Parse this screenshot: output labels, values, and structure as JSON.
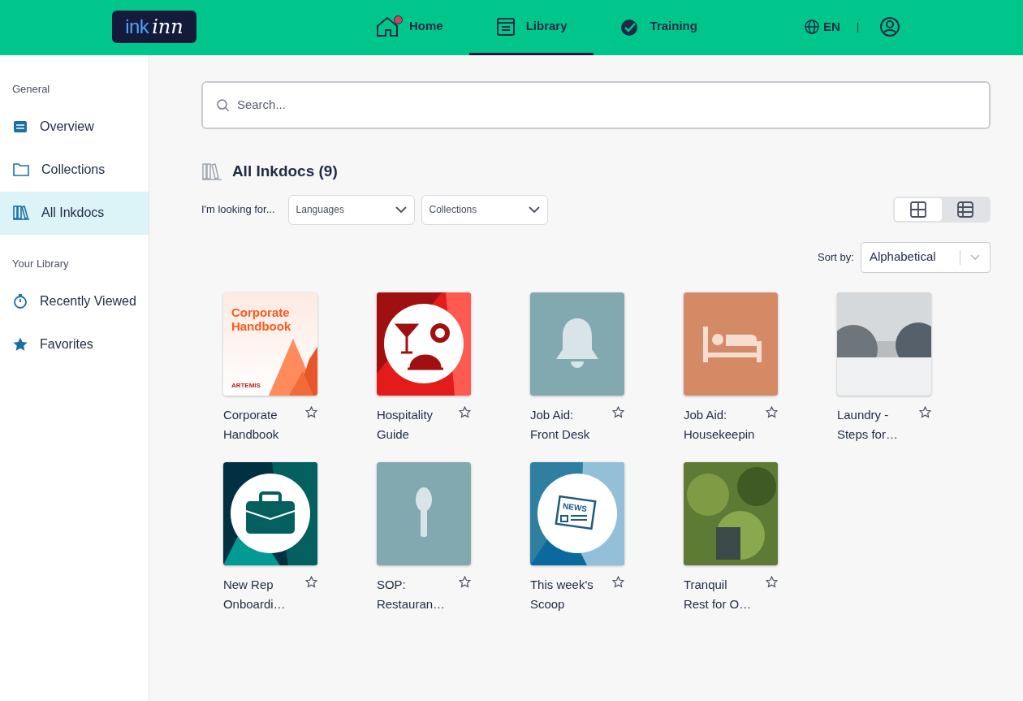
{
  "header": {
    "logo_left": "ink",
    "logo_right": "inn",
    "nav": [
      {
        "label": "Home",
        "kind": "home",
        "selected": false,
        "badge": true
      },
      {
        "label": "Library",
        "kind": "library",
        "selected": true,
        "badge": false
      },
      {
        "label": "Training",
        "kind": "training",
        "selected": false,
        "badge": false
      }
    ],
    "language": "EN"
  },
  "sidebar": {
    "sections": [
      {
        "heading": "General",
        "items": [
          {
            "label": "Overview",
            "kind": "overview",
            "selected": false
          },
          {
            "label": "Collections",
            "kind": "folder",
            "selected": false
          },
          {
            "label": "All Inkdocs",
            "kind": "books",
            "selected": true
          }
        ]
      },
      {
        "heading": "Your Library",
        "items": [
          {
            "label": "Recently Viewed",
            "kind": "timer",
            "selected": false
          },
          {
            "label": "Favorites",
            "kind": "star",
            "selected": false
          }
        ]
      }
    ]
  },
  "search": {
    "placeholder": "Search..."
  },
  "heading": "All Inkdocs (9)",
  "filters": {
    "label": "I'm looking for...",
    "dropdowns": [
      "Languages",
      "Collections"
    ]
  },
  "view_toggle": [
    {
      "kind": "grid",
      "selected": true
    },
    {
      "kind": "list",
      "selected": false
    }
  ],
  "sort": {
    "label": "Sort by:",
    "value": "Alphabetical"
  },
  "docs": [
    {
      "title": "Corporate Handbook",
      "kind": "handbook",
      "cover_title": "Corporate Handbook",
      "cover_brand": "ARTEMIS",
      "favorite": false
    },
    {
      "title": "Hospitality Guide",
      "kind": "hospitality",
      "favorite": false
    },
    {
      "title": "Job Aid: Front Desk",
      "kind": "bell",
      "favorite": false
    },
    {
      "title": "Job Aid: Housekeepin",
      "kind": "bed",
      "favorite": false
    },
    {
      "title": "Laundry - Steps for…",
      "kind": "photo",
      "favorite": false
    },
    {
      "title": "New Rep Onboardi…",
      "kind": "briefcase",
      "favorite": false
    },
    {
      "title": "SOP: Restauran…",
      "kind": "spoon",
      "favorite": false
    },
    {
      "title": "This week's Scoop",
      "kind": "news",
      "cover_label": "NEWS",
      "favorite": false
    },
    {
      "title": "Tranquil Rest for O…",
      "kind": "garden",
      "favorite": false
    }
  ]
}
